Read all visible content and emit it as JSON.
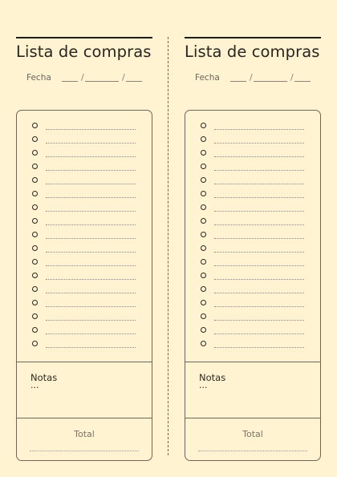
{
  "cards": [
    {
      "title": "Lista de compras",
      "date_label": "Fecha",
      "date_sep": "/",
      "item_count": 17,
      "notes_label": "Notas",
      "notes_text": "...",
      "total_label": "Total"
    },
    {
      "title": "Lista de compras",
      "date_label": "Fecha",
      "date_sep": "/",
      "item_count": 17,
      "notes_label": "Notas",
      "notes_text": "...",
      "total_label": "Total"
    }
  ]
}
